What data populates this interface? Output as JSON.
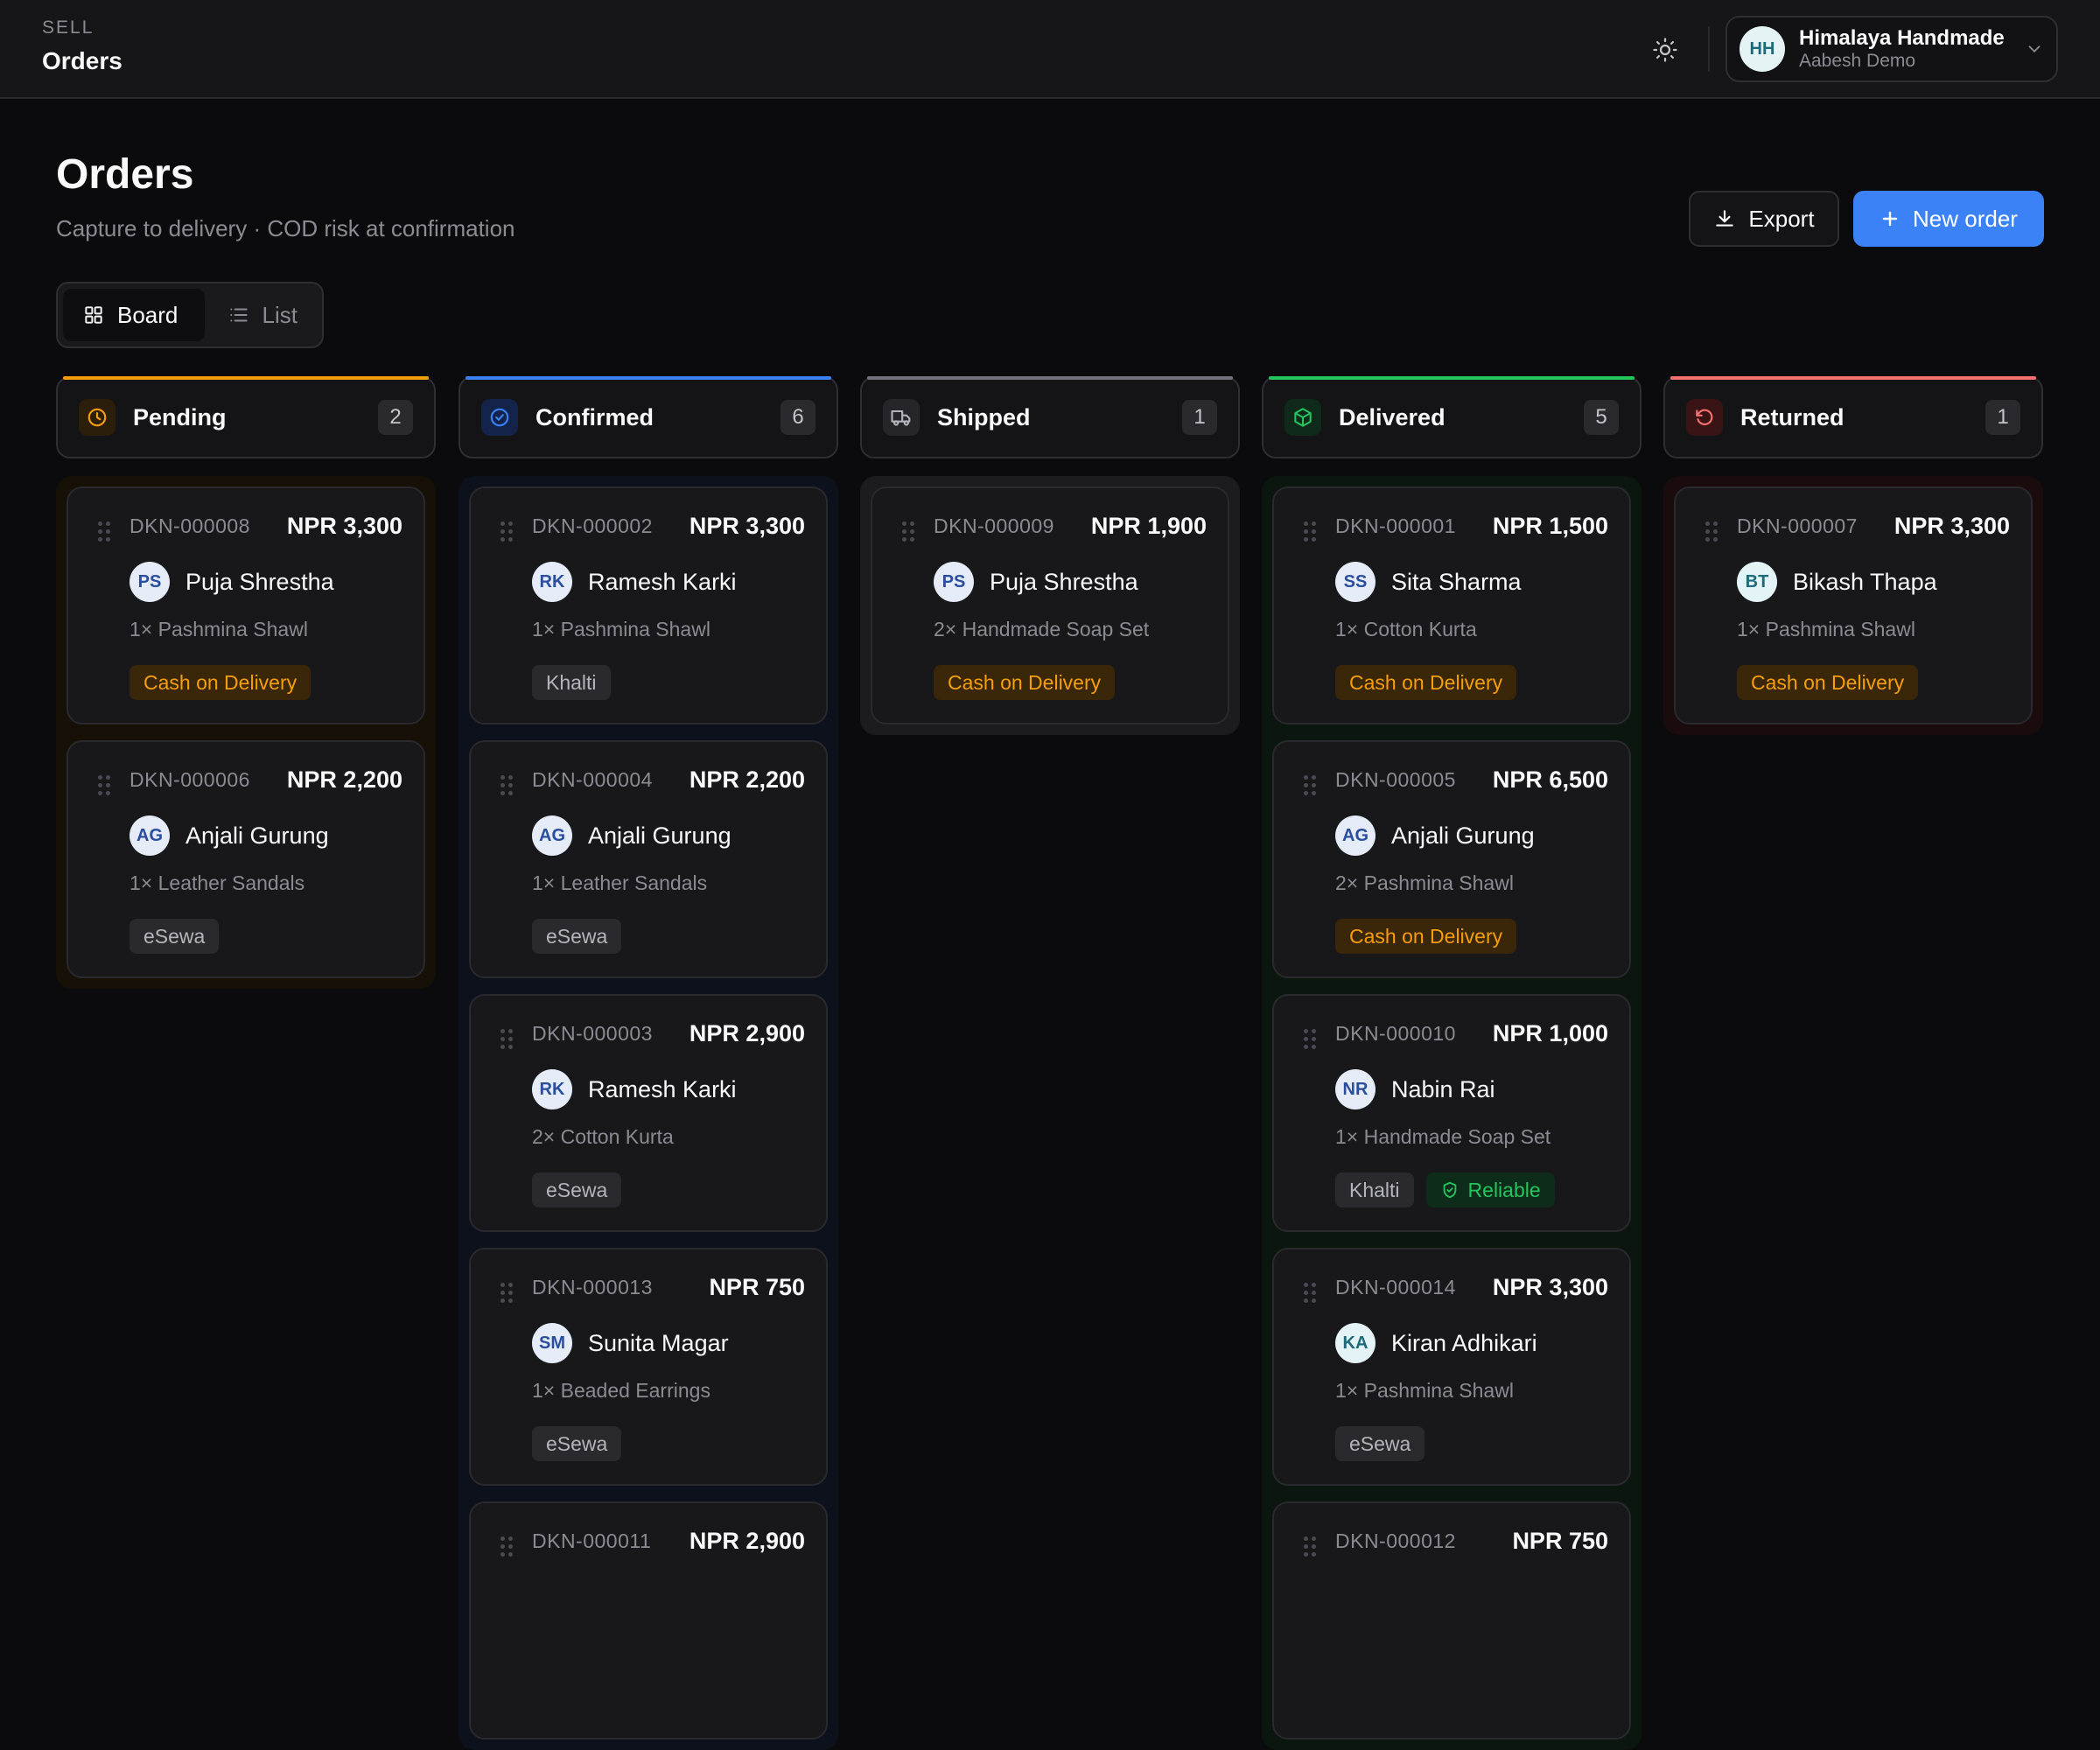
{
  "topbar": {
    "section": "SELL",
    "title": "Orders",
    "account": {
      "initials": "HH",
      "name": "Himalaya Handmade",
      "sub": "Aabesh Demo"
    }
  },
  "header": {
    "title": "Orders",
    "subtitle": "Capture to delivery · COD risk at confirmation",
    "export_label": "Export",
    "new_label": "New order"
  },
  "view_toggle": {
    "board_label": "Board",
    "list_label": "List"
  },
  "colors": {
    "pending": "#f59e0b",
    "confirmed": "#3b82f6",
    "shipped": "#71717a",
    "delivered": "#22c55e",
    "returned": "#f87171"
  },
  "columns": [
    {
      "key": "pending",
      "label": "Pending",
      "count": "2",
      "cards": [
        {
          "id": "DKN-000008",
          "amount": "NPR 3,300",
          "initials": "PS",
          "customer": "Puja Shrestha",
          "item": "1× Pashmina Shawl",
          "payment": "Cash on Delivery"
        },
        {
          "id": "DKN-000006",
          "amount": "NPR 2,200",
          "initials": "AG",
          "customer": "Anjali Gurung",
          "item": "1× Leather Sandals",
          "payment": "eSewa"
        }
      ]
    },
    {
      "key": "confirmed",
      "label": "Confirmed",
      "count": "6",
      "cards": [
        {
          "id": "DKN-000002",
          "amount": "NPR 3,300",
          "initials": "RK",
          "customer": "Ramesh Karki",
          "item": "1× Pashmina Shawl",
          "payment": "Khalti"
        },
        {
          "id": "DKN-000004",
          "amount": "NPR 2,200",
          "initials": "AG",
          "customer": "Anjali Gurung",
          "item": "1× Leather Sandals",
          "payment": "eSewa"
        },
        {
          "id": "DKN-000003",
          "amount": "NPR 2,900",
          "initials": "RK",
          "customer": "Ramesh Karki",
          "item": "2× Cotton Kurta",
          "payment": "eSewa"
        },
        {
          "id": "DKN-000013",
          "amount": "NPR 750",
          "initials": "SM",
          "customer": "Sunita Magar",
          "item": "1× Beaded Earrings",
          "payment": "eSewa"
        },
        {
          "id": "DKN-000011",
          "amount": "NPR 2,900",
          "initials": "",
          "customer": "",
          "item": "",
          "payment": ""
        }
      ]
    },
    {
      "key": "shipped",
      "label": "Shipped",
      "count": "1",
      "cards": [
        {
          "id": "DKN-000009",
          "amount": "NPR 1,900",
          "initials": "PS",
          "customer": "Puja Shrestha",
          "item": "2× Handmade Soap Set",
          "payment": "Cash on Delivery"
        }
      ]
    },
    {
      "key": "delivered",
      "label": "Delivered",
      "count": "5",
      "cards": [
        {
          "id": "DKN-000001",
          "amount": "NPR 1,500",
          "initials": "SS",
          "customer": "Sita Sharma",
          "item": "1× Cotton Kurta",
          "payment": "Cash on Delivery"
        },
        {
          "id": "DKN-000005",
          "amount": "NPR 6,500",
          "initials": "AG",
          "customer": "Anjali Gurung",
          "item": "2× Pashmina Shawl",
          "payment": "Cash on Delivery"
        },
        {
          "id": "DKN-000010",
          "amount": "NPR 1,000",
          "initials": "NR",
          "customer": "Nabin Rai",
          "item": "1× Handmade Soap Set",
          "payment": "Khalti",
          "badge": "Reliable"
        },
        {
          "id": "DKN-000014",
          "amount": "NPR 3,300",
          "initials": "KA",
          "customer": "Kiran Adhikari",
          "item": "1× Pashmina Shawl",
          "payment": "eSewa"
        },
        {
          "id": "DKN-000012",
          "amount": "NPR 750",
          "initials": "",
          "customer": "",
          "item": "",
          "payment": ""
        }
      ]
    },
    {
      "key": "returned",
      "label": "Returned",
      "count": "1",
      "cards": [
        {
          "id": "DKN-000007",
          "amount": "NPR 3,300",
          "initials": "BT",
          "customer": "Bikash Thapa",
          "item": "1× Pashmina Shawl",
          "payment": "Cash on Delivery"
        }
      ]
    }
  ]
}
